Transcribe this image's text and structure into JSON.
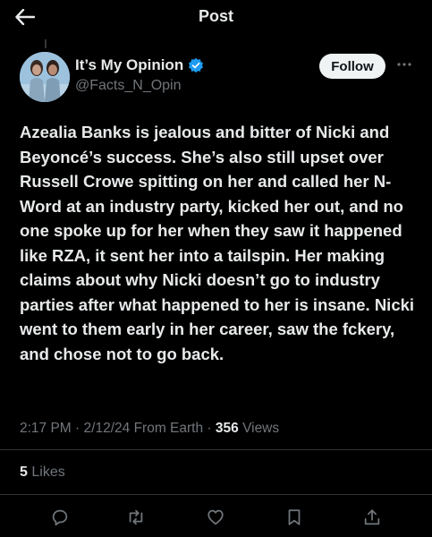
{
  "header": {
    "title": "Post",
    "back_icon": "arrow-left-icon"
  },
  "author": {
    "display_name": "It’s My Opinion",
    "handle": "@Facts_N_Opin",
    "verified": true,
    "verified_color": "#1d9bf0"
  },
  "follow_button": {
    "label": "Follow"
  },
  "more_icon": "more-horizontal-icon",
  "post": {
    "text": "Azealia Banks is jealous and bitter of Nicki and Beyoncé’s success. She’s also still upset over Russell Crowe spitting on her and called her N-Word at an industry party, kicked her out, and no one spoke up for her when they saw it happened like RZA, it sent her into a tailspin. Her making claims about why Nicki doesn’t go to industry parties after what happened to her is insane. Nicki went to them early in her career, saw the fckery, and chose not to go back."
  },
  "meta": {
    "time": "2:17 PM",
    "date": "2/12/24",
    "source": "From Earth",
    "views_count": "356",
    "views_label": "Views",
    "separator": "·"
  },
  "engagement": {
    "likes_count": "5",
    "likes_label": "Likes"
  },
  "actions": [
    {
      "icon": "reply-icon"
    },
    {
      "icon": "repost-icon"
    },
    {
      "icon": "like-icon"
    },
    {
      "icon": "bookmark-icon"
    },
    {
      "icon": "share-icon"
    }
  ],
  "colors": {
    "background": "#000000",
    "text": "#e7e9ea",
    "secondary": "#71767b",
    "divider": "#2f3336",
    "accent": "#1d9bf0"
  }
}
